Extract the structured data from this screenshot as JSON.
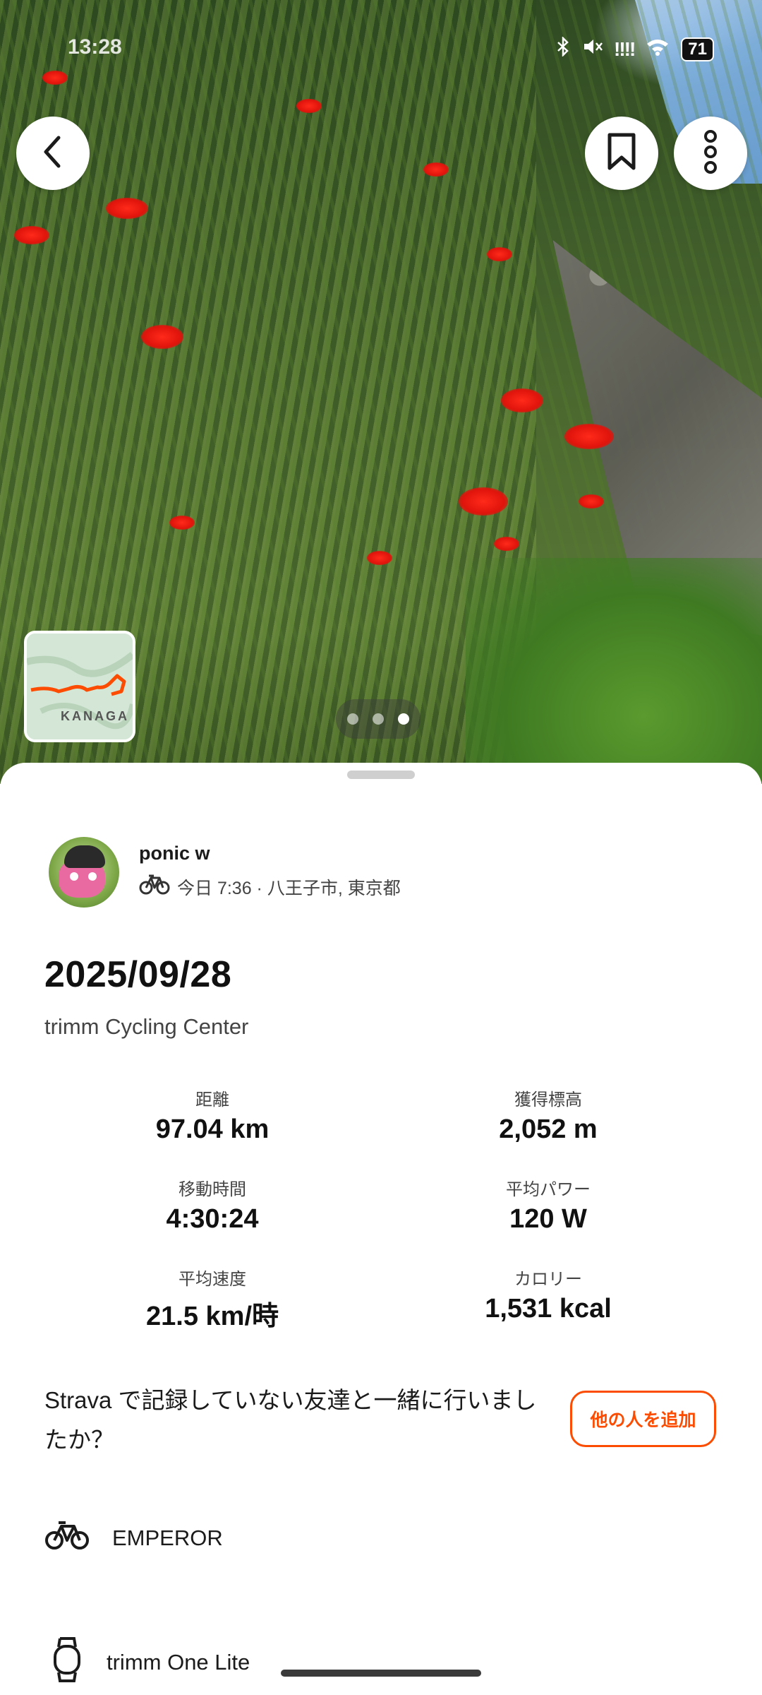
{
  "status_bar": {
    "time": "13:28",
    "battery": "71",
    "signal": "!!!!"
  },
  "hero": {
    "map_label": "KANAGA",
    "photo_count": 3,
    "active_photo_index": 3
  },
  "activity": {
    "athlete_name": "ponic w",
    "meta": "今日 7:36 · 八王子市, 東京都",
    "title": "2025/09/28",
    "subtitle": "trimm Cycling Center"
  },
  "stats": [
    {
      "label": "距離",
      "value": "97.04 km"
    },
    {
      "label": "獲得標高",
      "value": "2,052 m"
    },
    {
      "label": "移動時間",
      "value": "4:30:24"
    },
    {
      "label": "平均パワー",
      "value": "120 W"
    },
    {
      "label": "平均速度",
      "value": "21.5 km/時"
    },
    {
      "label": "カロリー",
      "value": "1,531 kcal"
    }
  ],
  "friends_prompt": {
    "text": "Strava で記録していない友達と一緒に行いましたか？",
    "button_label": "他の人を追加"
  },
  "gear": [
    {
      "icon": "bike-icon",
      "label": "EMPEROR"
    },
    {
      "icon": "watch-icon",
      "label": "trimm One Lite"
    }
  ],
  "colors": {
    "accent": "#fc4c02",
    "text": "#1b1b1b"
  }
}
